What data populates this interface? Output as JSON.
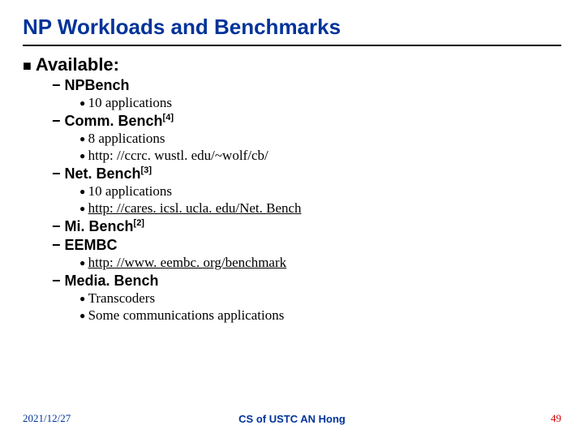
{
  "title": "NP Workloads and Benchmarks",
  "lvl1": "Available:",
  "items": {
    "npbench": {
      "label": "NPBench",
      "sub1": "10 applications"
    },
    "commbench": {
      "label": "Comm. Bench",
      "ref": "[4]",
      "sub1": "8 applications",
      "sub2": "http: //ccrc. wustl. edu/~wolf/cb/"
    },
    "netbench": {
      "label": "Net. Bench",
      "ref": "[3]",
      "sub1": "10 applications",
      "sub2": "http: //cares. icsl. ucla. edu/Net. Bench"
    },
    "mibench": {
      "label": "Mi. Bench",
      "ref": "[2]"
    },
    "eembc": {
      "label": "EEMBC",
      "sub1": "http: //www. eembc. org/benchmark"
    },
    "mediabench": {
      "label": "Media. Bench",
      "sub1": "Transcoders",
      "sub2": "Some communications applications"
    }
  },
  "footer": {
    "left": "2021/12/27",
    "center": "CS of USTC AN Hong",
    "right": "49"
  }
}
